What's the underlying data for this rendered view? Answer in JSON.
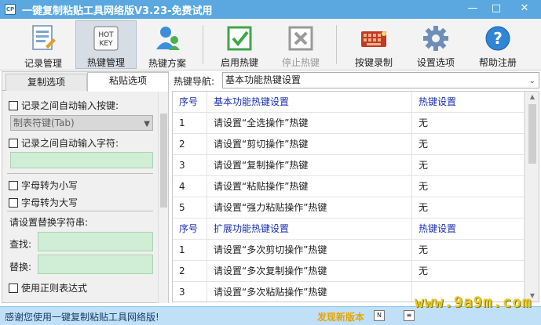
{
  "window": {
    "title": "一键复制粘贴工具网络版V3.23-免费试用",
    "icon_label": "CP"
  },
  "toolbar": {
    "items": [
      {
        "label": "记录管理",
        "icon": "document-list-icon"
      },
      {
        "label": "热键管理",
        "icon": "hotkey-icon",
        "icon_text": "HOT\nKEY",
        "active": true
      },
      {
        "label": "热键方案",
        "icon": "users-icon"
      },
      {
        "label": "启用热键",
        "icon": "green-check-icon"
      },
      {
        "label": "停止热键",
        "icon": "gray-x-icon",
        "disabled": true
      },
      {
        "label": "按键录制",
        "icon": "keyboard-record-icon"
      },
      {
        "label": "设置选项",
        "icon": "gear-icon"
      },
      {
        "label": "帮助注册",
        "icon": "help-icon"
      }
    ]
  },
  "left_panel": {
    "tabs": [
      "复制选项",
      "粘贴选项"
    ],
    "active_tab": "粘贴选项",
    "auto_key_label": "记录之间自动输入按键:",
    "auto_key_value": "制表符键(Tab)",
    "auto_char_label": "记录之间自动输入字符:",
    "to_lower_label": "字母转为小写",
    "to_upper_label": "字母转为大写",
    "replace_title": "请设置替换字符串:",
    "find_label": "查找:",
    "replace_label": "替换:",
    "regex_label": "使用正则表达式"
  },
  "nav": {
    "label": "热键导航:",
    "selected": "基本功能热键设置"
  },
  "grid": {
    "rows": [
      {
        "head": true,
        "no": "序号",
        "name": "基本功能热键设置",
        "setting": "热键设置"
      },
      {
        "no": "1",
        "name": "请设置“全选操作”热键",
        "setting": "无"
      },
      {
        "no": "2",
        "name": "请设置“剪切操作”热键",
        "setting": "无"
      },
      {
        "no": "3",
        "name": "请设置“复制操作”热键",
        "setting": "无"
      },
      {
        "no": "4",
        "name": "请设置“粘贴操作”热键",
        "setting": "无"
      },
      {
        "no": "5",
        "name": "请设置“强力粘贴操作”热键",
        "setting": "无"
      },
      {
        "head": true,
        "no": "序号",
        "name": "扩展功能热键设置",
        "setting": "热键设置"
      },
      {
        "no": "1",
        "name": "请设置“多次剪切操作”热键",
        "setting": "无"
      },
      {
        "no": "2",
        "name": "请设置“多次复制操作”热键",
        "setting": "无"
      },
      {
        "no": "3",
        "name": "请设置“多次粘贴操作”热键",
        "setting": ""
      }
    ]
  },
  "status": {
    "left": "感谢您使用一键复制粘贴工具网络版!",
    "new_version": "发现新版本",
    "watermark": "www.9a9m.com"
  },
  "colors": {
    "titlebar": "#5aa8df",
    "statusbar": "#bfe0f7",
    "header_text": "#1a2fb0",
    "green_box": "#cfeed5"
  }
}
